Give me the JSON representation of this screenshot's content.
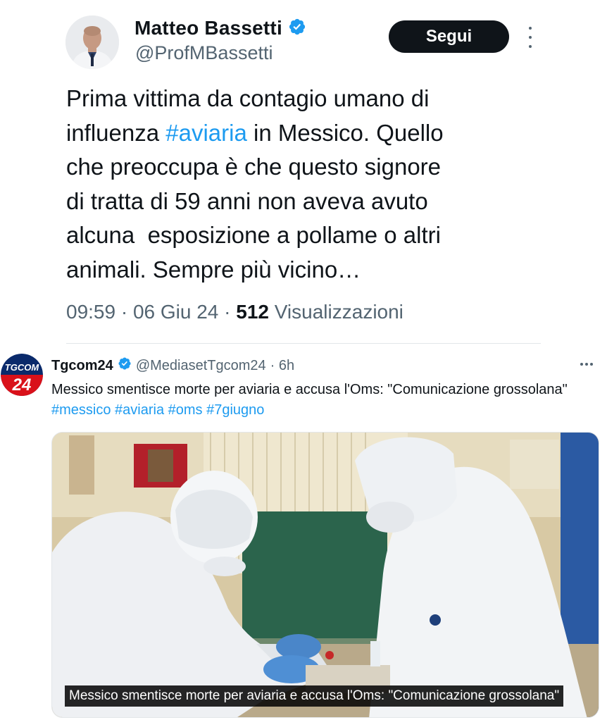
{
  "tweet": {
    "author": {
      "name": "Matteo Bassetti",
      "handle": "@ProfMBassetti",
      "verified_color": "#1d9bf0"
    },
    "follow_label": "Segui",
    "text": {
      "before": "Prima vittima da contagio umano di\ninfluenza ",
      "hashtag": "#aviaria",
      "after": " in Messico. Quello\nche preoccupa è che questo signore\ndi tratta di 59 anni non aveva avuto\nalcuna  esposizione a pollame o altri\nanimali. Sempre più vicino…"
    },
    "meta": {
      "time_date": "09:59 · 06 Giu 24 · ",
      "views_count": "512",
      "views_label": " Visualizzazioni"
    }
  },
  "quoted": {
    "author": {
      "name": "Tgcom24",
      "handle": "@MediasetTgcom24",
      "age": "· 6h",
      "logo_top": "TGCOM",
      "logo_bottom": "24"
    },
    "text": "Messico smentisce morte per aviaria e accusa l'Oms: \"Comunicazione grossolana\"  ",
    "hashtags": "#messico #aviaria #oms #7giugno",
    "media_caption": "Messico smentisce morte per aviaria e accusa l'Oms: \"Comunicazione grossolana\""
  },
  "colors": {
    "text": "#0f1419",
    "secondary": "#536471",
    "link": "#1d9bf0",
    "button": "#0f1419"
  },
  "icons": [
    "verified-badge-icon",
    "more-vertical-icon",
    "more-horizontal-icon"
  ]
}
